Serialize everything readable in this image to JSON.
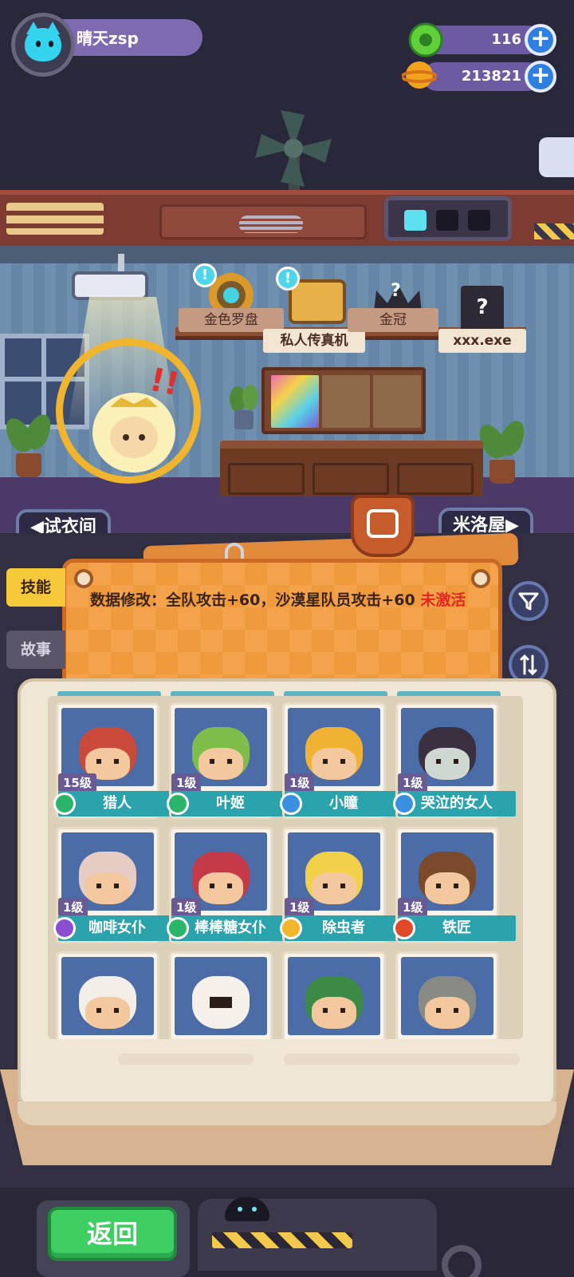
{
  "profile": {
    "name": "晴天zsp",
    "avatar_icon": "cat-avatar-icon"
  },
  "currencies": [
    {
      "name": "green-gem",
      "value": "116",
      "color": "#5fcf3a"
    },
    {
      "name": "gold-coin",
      "value": "213821",
      "color": "#f2a21c"
    }
  ],
  "showcase": {
    "items": [
      {
        "label": "金色罗盘",
        "icon": "golden-compass-icon",
        "alert": "!"
      },
      {
        "label": "私人传真机",
        "icon": "fax-machine-icon",
        "alert": "!"
      },
      {
        "label": "金冠",
        "icon": "golden-crown-icon",
        "locked_mark": "?"
      },
      {
        "label": "xxx.exe",
        "icon": "file-icon",
        "locked_mark": "?"
      }
    ]
  },
  "room_nav": {
    "left": "◀试衣间",
    "right": "米洛屋▶"
  },
  "side_tabs": [
    {
      "label": "技能",
      "active": true
    },
    {
      "label": "故事",
      "active": false
    }
  ],
  "skill": {
    "text": "数据修改：全队攻击+60，沙漠星队员攻击+60 ",
    "status": "未激活"
  },
  "characters": [
    {
      "level": "15级",
      "name": "猎人",
      "role_color": "#2bb56a",
      "hair": "#c94a3a"
    },
    {
      "level": "1级",
      "name": "叶姬",
      "role_color": "#2bb56a",
      "hair": "#7ebd4a"
    },
    {
      "level": "1级",
      "name": "小瞳",
      "role_color": "#3a8fe0",
      "hair": "#f0b233"
    },
    {
      "level": "1级",
      "name": "哭泣的女人",
      "role_color": "#3a8fe0",
      "hair": "#3a3040"
    },
    {
      "level": "1级",
      "name": "咖啡女仆",
      "role_color": "#8a4fd0",
      "hair": "#e6ccc2"
    },
    {
      "level": "1级",
      "name": "棒棒糖女仆",
      "role_color": "#2bb56a",
      "hair": "#c43a48"
    },
    {
      "level": "1级",
      "name": "除虫者",
      "role_color": "#f0b72b",
      "hair": "#f2d04a"
    },
    {
      "level": "1级",
      "name": "铁匠",
      "role_color": "#e04a2b",
      "hair": "#7a4a2a"
    },
    {
      "hair": "#f3efe8"
    },
    {
      "hair": "#f5f1ea"
    },
    {
      "hair": "#3c8a46"
    },
    {
      "hair": "#8a8a84"
    }
  ],
  "bottom": {
    "back_label": "返回"
  }
}
